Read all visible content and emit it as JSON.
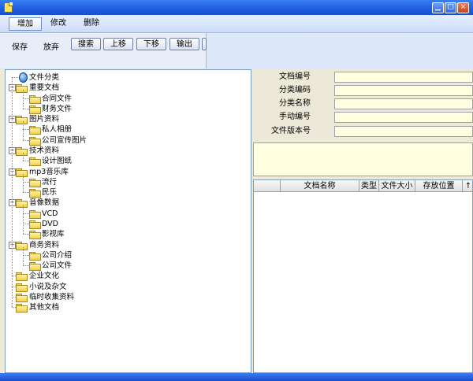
{
  "menu": {
    "add": "增加",
    "edit": "修改",
    "delete": "删除"
  },
  "toolbar": {
    "save": "保存",
    "discard": "放弃",
    "search": "搜索",
    "move_up": "上移",
    "move_down": "下移",
    "export": "输出"
  },
  "tree": {
    "root": "文件分类",
    "items": [
      {
        "label": "重要文档",
        "level": 1,
        "expander": "−"
      },
      {
        "label": "合同文件",
        "level": 2
      },
      {
        "label": "财务文件",
        "level": 2
      },
      {
        "label": "图片资料",
        "level": 1,
        "expander": "−"
      },
      {
        "label": "私人相册",
        "level": 2
      },
      {
        "label": "公司宣传图片",
        "level": 2
      },
      {
        "label": "技术资料",
        "level": 1,
        "expander": "−"
      },
      {
        "label": "设计图纸",
        "level": 2
      },
      {
        "label": "mp3音乐库",
        "level": 1,
        "expander": "−"
      },
      {
        "label": "流行",
        "level": 2
      },
      {
        "label": "民乐",
        "level": 2
      },
      {
        "label": "音像数据",
        "level": 1,
        "expander": "−"
      },
      {
        "label": "VCD",
        "level": 2
      },
      {
        "label": "DVD",
        "level": 2
      },
      {
        "label": "影视库",
        "level": 2
      },
      {
        "label": "商务资料",
        "level": 1,
        "expander": "−"
      },
      {
        "label": "公司介绍",
        "level": 2
      },
      {
        "label": "公司文件",
        "level": 2
      },
      {
        "label": "企业文化",
        "level": 1
      },
      {
        "label": "小说及杂文",
        "level": 1
      },
      {
        "label": "临时收集资料",
        "level": 1
      },
      {
        "label": "其他文档",
        "level": 1
      }
    ]
  },
  "form": {
    "doc_no": "文档编号",
    "category_code": "分类编码",
    "category_name": "分类名称",
    "manual_no": "手动编号",
    "version_no": "文件版本号"
  },
  "grid": {
    "columns": [
      "",
      "文档名称",
      "类型",
      "文件大小",
      "存放位置",
      "↑"
    ]
  }
}
